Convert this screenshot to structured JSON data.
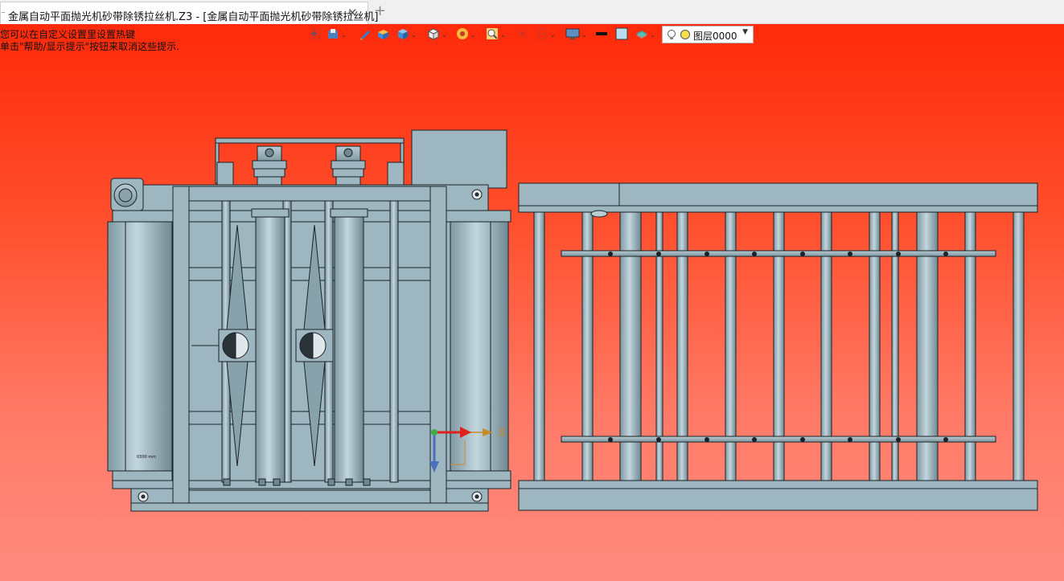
{
  "tab": {
    "title": "金属自动平面抛光机砂带除锈拉丝机.Z3 - [金属自动平面抛光机砂带除锈拉丝机]",
    "close_glyph": "✕",
    "add_glyph": "+"
  },
  "hint": {
    "line1": "您可以在自定义设置里设置热键",
    "line2": "单击\"帮助/显示提示\"按钮来取消这些提示."
  },
  "toolbar": {
    "icons": [
      "exit-icon",
      "save-view-icon",
      "pen-icon",
      "solid-icon",
      "cube-icon",
      "view-cube-icon",
      "render-icon",
      "zoom-icon",
      "fit-icon",
      "section-icon",
      "display-icon",
      "line-color-swatch",
      "fill-color-swatch",
      "layer-stack-icon"
    ],
    "layer": {
      "name": "图层0000",
      "bulb_icon": "lightbulb-icon",
      "color_icon": "yellow-circle-icon"
    }
  },
  "viewport": {
    "background_top": "#ff2a0a",
    "background_bottom": "#ff8b80",
    "model_color": "#9db6c0",
    "axis_label_x": "X",
    "machine_label": "0300 mm"
  }
}
